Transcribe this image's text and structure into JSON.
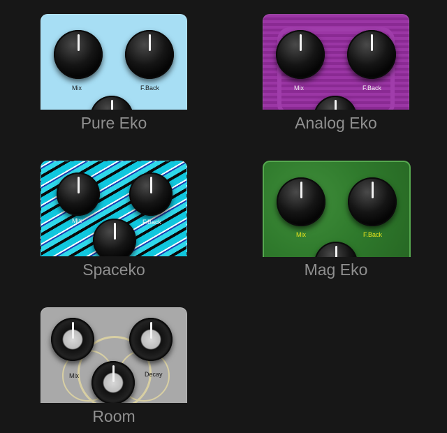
{
  "pedals": [
    {
      "name": "Pure Eko",
      "knob_labels": [
        "Mix",
        "F.Back"
      ]
    },
    {
      "name": "Analog Eko",
      "knob_labels": [
        "Mix",
        "F.Back"
      ]
    },
    {
      "name": "Spaceko",
      "knob_labels": [
        "Mix",
        "F.Back"
      ]
    },
    {
      "name": "Mag Eko",
      "knob_labels": [
        "Mix",
        "F.Back"
      ]
    },
    {
      "name": "Room",
      "knob_labels": [
        "Mix",
        "Decay"
      ]
    }
  ],
  "icons": [
    "knob-icon"
  ],
  "colors": {
    "background": "#171717",
    "label": "#8f8f8f",
    "pure_eko": "#a7def4",
    "analog_eko": "#8a2a93",
    "spaceko": "#10c7de",
    "mag_eko": "#2f7a2c",
    "room": "#a9a9a9",
    "mag_label": "#e9e21c"
  }
}
